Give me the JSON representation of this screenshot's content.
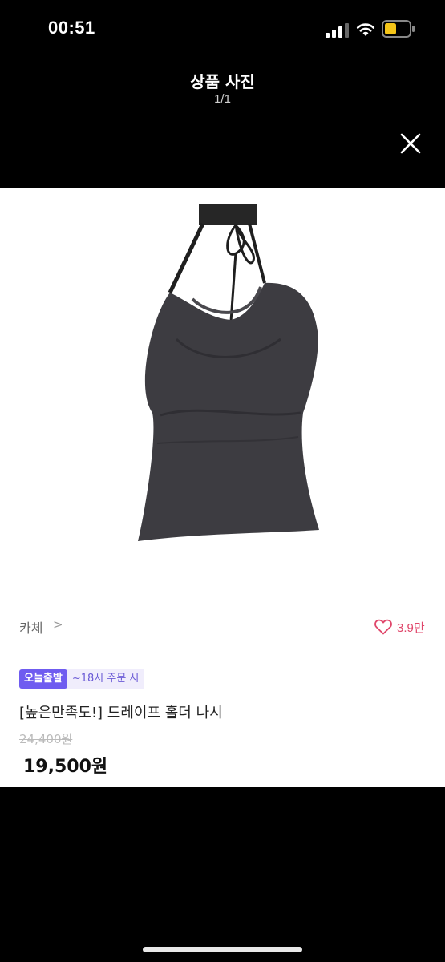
{
  "status_bar": {
    "time": "00:51"
  },
  "viewer": {
    "title": "상품 사진",
    "counter": "1/1"
  },
  "product": {
    "brand": "카체",
    "brand_chevron": ">",
    "likes": "3.9만",
    "badge_fast": "오늘출발",
    "badge_cutoff": "~18시 주문 시",
    "title": "[높은만족도!] 드레이프 홀더 나시",
    "original_price": "24,400원",
    "sale_price": "19,500원"
  },
  "colors": {
    "background": "#000000",
    "card": "#ffffff",
    "accent": "#6f5cf0",
    "like": "#e0476b"
  },
  "icons": {
    "close": "close-icon",
    "like": "heart-outline-icon",
    "signal": "signal-icon",
    "wifi": "wifi-icon",
    "battery": "battery-icon"
  }
}
